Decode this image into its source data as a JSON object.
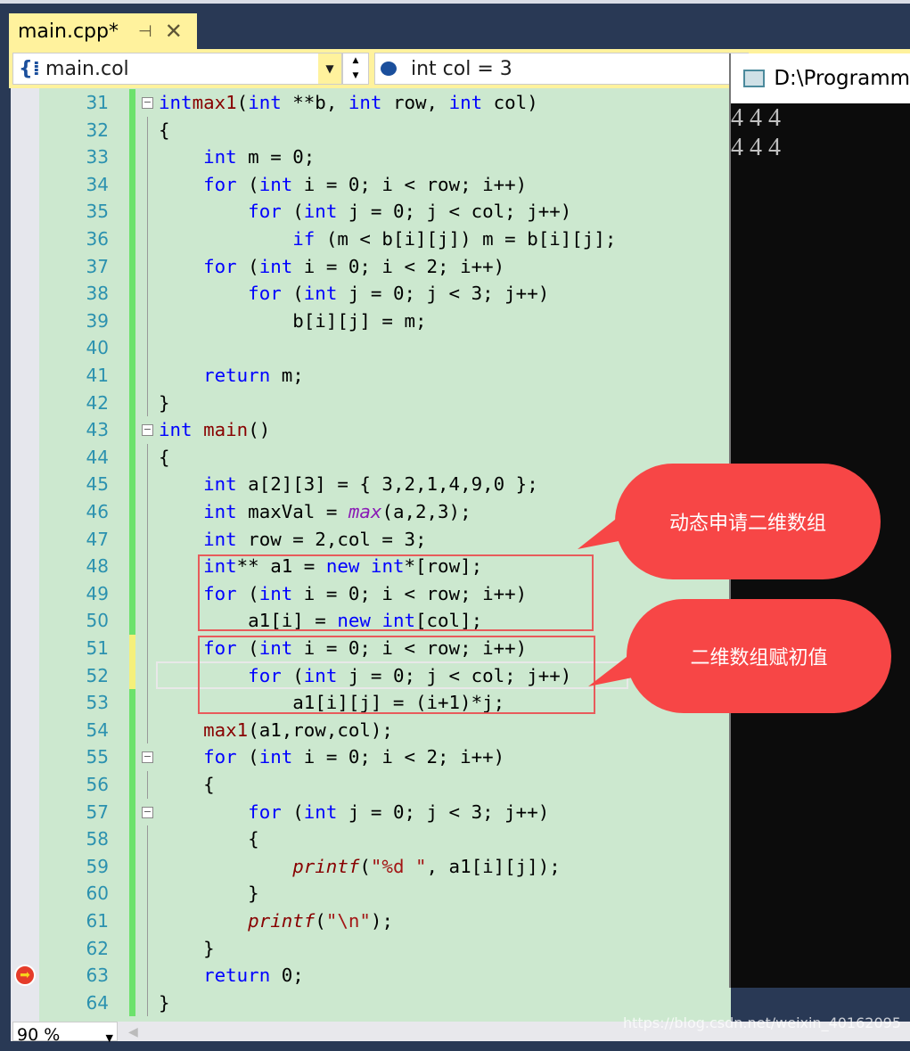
{
  "tab": {
    "title": "main.cpp*",
    "pin_icon": "pin-icon",
    "close_icon": "close-icon"
  },
  "navbar": {
    "scope": "main.col",
    "member": "int col = 3"
  },
  "editor": {
    "zoom": "90 %",
    "lines": [
      {
        "n": "31",
        "t": [
          [
            "k",
            "int"
          ],
          [
            "",
            "",
            " "
          ],
          [
            "f",
            "max1"
          ],
          [
            "",
            "("
          ],
          [
            "k",
            "int"
          ],
          [
            "",
            " **b, "
          ],
          [
            "k",
            "int"
          ],
          [
            "",
            " row, "
          ],
          [
            "k",
            "int"
          ],
          [
            "",
            " col)"
          ]
        ]
      },
      {
        "n": "32",
        "t": [
          [
            "",
            "{"
          ]
        ]
      },
      {
        "n": "33",
        "t": [
          [
            "",
            "    "
          ],
          [
            "k",
            "int"
          ],
          [
            "",
            " m = 0;"
          ]
        ]
      },
      {
        "n": "34",
        "t": [
          [
            "",
            "    "
          ],
          [
            "k",
            "for"
          ],
          [
            "",
            " ("
          ],
          [
            "k",
            "int"
          ],
          [
            "",
            " i = 0; i < row; i++)"
          ]
        ]
      },
      {
        "n": "35",
        "t": [
          [
            "",
            "        "
          ],
          [
            "k",
            "for"
          ],
          [
            "",
            " ("
          ],
          [
            "k",
            "int"
          ],
          [
            "",
            " j = 0; j < col; j++)"
          ]
        ]
      },
      {
        "n": "36",
        "t": [
          [
            "",
            "            "
          ],
          [
            "k",
            "if"
          ],
          [
            "",
            " (m < b[i][j]) m = b[i][j];"
          ]
        ]
      },
      {
        "n": "37",
        "t": [
          [
            "",
            "    "
          ],
          [
            "k",
            "for"
          ],
          [
            "",
            " ("
          ],
          [
            "k",
            "int"
          ],
          [
            "",
            " i = 0; i < 2; i++)"
          ]
        ]
      },
      {
        "n": "38",
        "t": [
          [
            "",
            "        "
          ],
          [
            "k",
            "for"
          ],
          [
            "",
            " ("
          ],
          [
            "k",
            "int"
          ],
          [
            "",
            " j = 0; j < 3; j++)"
          ]
        ]
      },
      {
        "n": "39",
        "t": [
          [
            "",
            "            b[i][j] = m;"
          ]
        ]
      },
      {
        "n": "40",
        "t": []
      },
      {
        "n": "41",
        "t": [
          [
            "",
            "    "
          ],
          [
            "k",
            "return"
          ],
          [
            "",
            " m;"
          ]
        ]
      },
      {
        "n": "42",
        "t": [
          [
            "",
            "}"
          ]
        ]
      },
      {
        "n": "43",
        "t": [
          [
            "k",
            "int"
          ],
          [
            "",
            " "
          ],
          [
            "f",
            "main"
          ],
          [
            "",
            "()"
          ]
        ]
      },
      {
        "n": "44",
        "t": [
          [
            "",
            "{"
          ]
        ]
      },
      {
        "n": "45",
        "t": [
          [
            "",
            "    "
          ],
          [
            "k",
            "int"
          ],
          [
            "",
            " a[2][3] = { 3,2,1,4,9,0 };"
          ]
        ]
      },
      {
        "n": "46",
        "t": [
          [
            "",
            "    "
          ],
          [
            "k",
            "int"
          ],
          [
            "",
            " maxVal = "
          ],
          [
            "im",
            "max"
          ],
          [
            "",
            "(a,2,3);"
          ]
        ]
      },
      {
        "n": "47",
        "t": [
          [
            "",
            "    "
          ],
          [
            "k",
            "int"
          ],
          [
            "",
            " row = 2,col = 3;"
          ]
        ]
      },
      {
        "n": "48",
        "t": [
          [
            "",
            "    "
          ],
          [
            "k",
            "int"
          ],
          [
            "",
            "** a1 = "
          ],
          [
            "k",
            "new"
          ],
          [
            "",
            " "
          ],
          [
            "k",
            "int"
          ],
          [
            "",
            "*[row];"
          ]
        ]
      },
      {
        "n": "49",
        "t": [
          [
            "",
            "    "
          ],
          [
            "k",
            "for"
          ],
          [
            "",
            " ("
          ],
          [
            "k",
            "int"
          ],
          [
            "",
            " i = 0; i < row; i++)"
          ]
        ]
      },
      {
        "n": "50",
        "t": [
          [
            "",
            "        a1[i] = "
          ],
          [
            "k",
            "new"
          ],
          [
            "",
            " "
          ],
          [
            "k",
            "int"
          ],
          [
            "",
            "[col];"
          ]
        ]
      },
      {
        "n": "51",
        "t": [
          [
            "",
            "    "
          ],
          [
            "k",
            "for"
          ],
          [
            "",
            " ("
          ],
          [
            "k",
            "int"
          ],
          [
            "",
            " i = 0; i < row; i++)"
          ]
        ]
      },
      {
        "n": "52",
        "t": [
          [
            "",
            "        "
          ],
          [
            "k",
            "for"
          ],
          [
            "",
            " ("
          ],
          [
            "k",
            "int"
          ],
          [
            "",
            " j = 0; j < col; j++)"
          ]
        ]
      },
      {
        "n": "53",
        "t": [
          [
            "",
            "            a1[i][j] = (i+1)*j;"
          ]
        ]
      },
      {
        "n": "54",
        "t": [
          [
            "",
            "    "
          ],
          [
            "f",
            "max1"
          ],
          [
            "",
            "(a1,row,col);"
          ]
        ]
      },
      {
        "n": "55",
        "t": [
          [
            "",
            "    "
          ],
          [
            "k",
            "for"
          ],
          [
            "",
            " ("
          ],
          [
            "k",
            "int"
          ],
          [
            "",
            " i = 0; i < 2; i++)"
          ]
        ]
      },
      {
        "n": "56",
        "t": [
          [
            "",
            "    {"
          ]
        ]
      },
      {
        "n": "57",
        "t": [
          [
            "",
            "        "
          ],
          [
            "k",
            "for"
          ],
          [
            "",
            " ("
          ],
          [
            "k",
            "int"
          ],
          [
            "",
            " j = 0; j < 3; j++)"
          ]
        ]
      },
      {
        "n": "58",
        "t": [
          [
            "",
            "        {"
          ]
        ]
      },
      {
        "n": "59",
        "t": [
          [
            "",
            "            "
          ],
          [
            "ip",
            "printf"
          ],
          [
            "",
            "("
          ],
          [
            "s",
            "\"%d \""
          ],
          [
            "",
            ", a1[i][j]);"
          ]
        ]
      },
      {
        "n": "60",
        "t": [
          [
            "",
            "        }"
          ]
        ]
      },
      {
        "n": "61",
        "t": [
          [
            "",
            "        "
          ],
          [
            "ip",
            "printf"
          ],
          [
            "",
            "("
          ],
          [
            "s",
            "\"\\n\""
          ],
          [
            "",
            ");"
          ]
        ]
      },
      {
        "n": "62",
        "t": [
          [
            "",
            "    }"
          ]
        ]
      },
      {
        "n": "63",
        "t": [
          [
            "",
            "    "
          ],
          [
            "k",
            "return"
          ],
          [
            "",
            " 0;"
          ]
        ]
      },
      {
        "n": "64",
        "t": [
          [
            "",
            "}"
          ]
        ]
      }
    ],
    "yellow_lines": [
      "51",
      "52"
    ],
    "current_line": "52",
    "breakpoint_line": "63"
  },
  "console": {
    "title": "D:\\Programm",
    "output": [
      "4 4 4",
      "4 4 4"
    ]
  },
  "annotations": [
    {
      "label": "动态申请二维数组",
      "color": "#f74646"
    },
    {
      "label": "二维数组赋初值",
      "color": "#f74646"
    }
  ],
  "watermark": "https://blog.csdn.net/weixin_40162095",
  "colors": {
    "keyword": "#0000ff",
    "function": "#880000",
    "string": "#a31515",
    "line_number": "#2b91af",
    "editor_bg": "#cce8cf",
    "tab": "#fff29d"
  }
}
